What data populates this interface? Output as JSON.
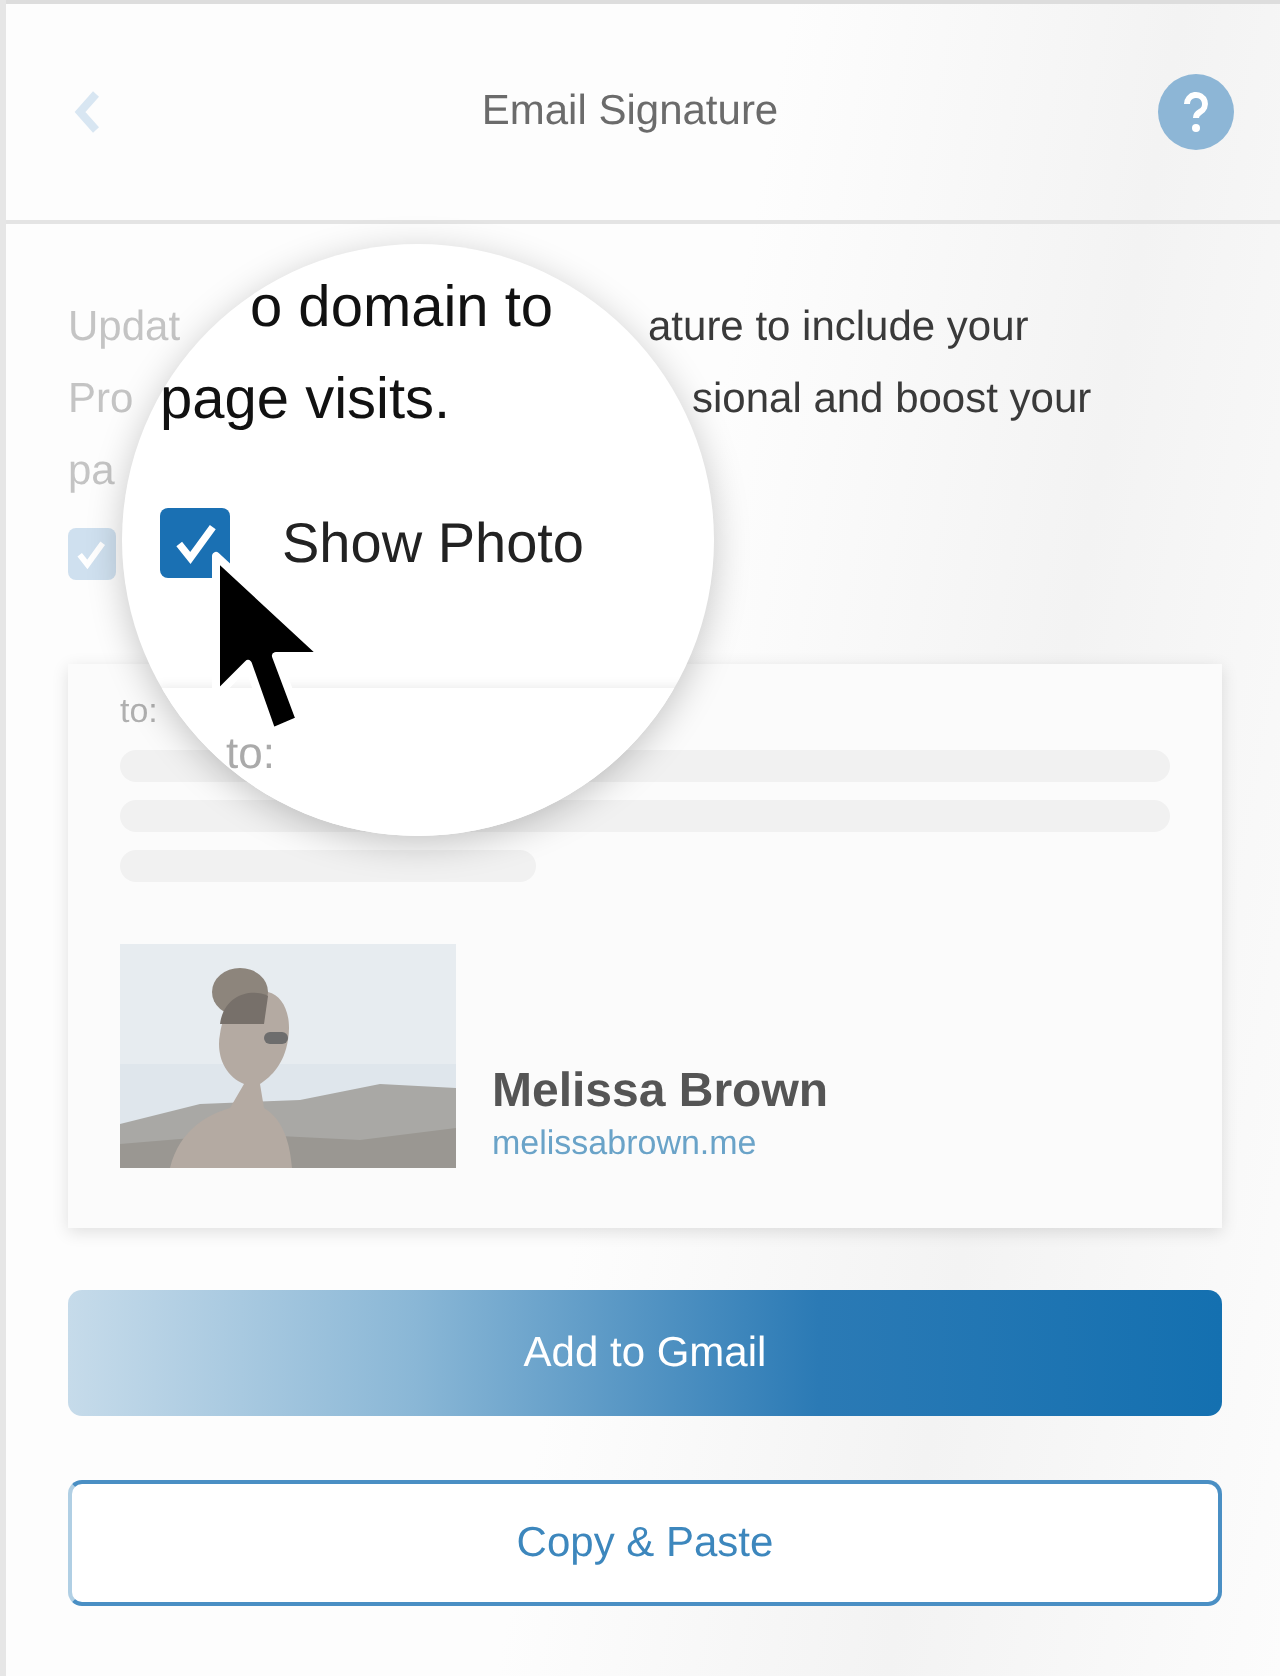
{
  "header": {
    "title": "Email Signature"
  },
  "intro_lines": [
    {
      "left": "Updat",
      "right": "ature to include your"
    },
    {
      "left": "Pro",
      "right": "sional and boost your"
    },
    {
      "left": "pa"
    }
  ],
  "show_photo_checkbox": {
    "checked": true
  },
  "signature_preview": {
    "to_label": "to:",
    "name": "Melissa Brown",
    "website": "melissabrown.me"
  },
  "buttons": [
    {
      "label": "Add to Gmail",
      "kind": "primary"
    },
    {
      "label": "Copy & Paste",
      "kind": "secondary"
    }
  ],
  "magnifier": {
    "lines": [
      "o domain to",
      "page visits."
    ],
    "checkbox": {
      "label": "Show Photo",
      "checked": true
    },
    "to_label": "to:"
  }
}
